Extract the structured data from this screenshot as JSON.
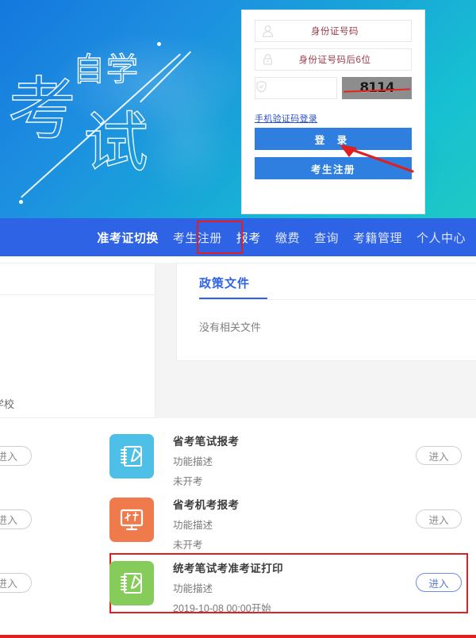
{
  "hero": {
    "word_top": "自学",
    "word_left": "考",
    "word_right": "试",
    "alt": "自学考试"
  },
  "login": {
    "fields": [
      {
        "icon": "user-icon",
        "placeholder": "身份证号码",
        "value": ""
      },
      {
        "icon": "lock-icon",
        "placeholder": "身份证号码后6位",
        "value": ""
      }
    ],
    "captcha": {
      "icon": "shield-icon",
      "value": "",
      "code": "8114"
    },
    "sms_link": "手机验证码登录",
    "login_button": "登 录",
    "register_button": "考生注册",
    "annotation": "red-arrow-to-login"
  },
  "nav": {
    "items": [
      {
        "label": "准考证切换",
        "state": "active"
      },
      {
        "label": "考生注册",
        "state": "normal"
      },
      {
        "label": "报考",
        "state": "highlighted"
      },
      {
        "label": "缴费",
        "state": "normal"
      },
      {
        "label": "查询",
        "state": "normal"
      },
      {
        "label": "考籍管理",
        "state": "normal"
      },
      {
        "label": "个人中心",
        "state": "normal"
      }
    ],
    "bar_color": "#2f63e5",
    "highlight_color": "#e02020"
  },
  "panels": {
    "left_footer": "学校",
    "right": {
      "tab_title": "政策文件",
      "empty_text": "没有相关文件",
      "accent_color": "#2f63e5"
    }
  },
  "list": {
    "edge_button": "进入",
    "rows": [
      {
        "icon": "notebook-pencil-icon",
        "icon_color": "#4ec0e8",
        "title": "省考笔试报考",
        "desc": "功能描述",
        "meta": "未开考",
        "button": "进入",
        "highlighted": false
      },
      {
        "icon": "monitor-icon",
        "icon_color": "#ef7b4d",
        "title": "省考机考报考",
        "desc": "功能描述",
        "meta": "未开考",
        "button": "进入",
        "highlighted": false
      },
      {
        "icon": "notebook-pencil-icon",
        "icon_color": "#86cc5a",
        "title": "统考笔试考准考证打印",
        "desc": "功能描述",
        "meta": "2019-10-08 00:00开始",
        "button": "进入",
        "highlighted": true
      }
    ]
  }
}
